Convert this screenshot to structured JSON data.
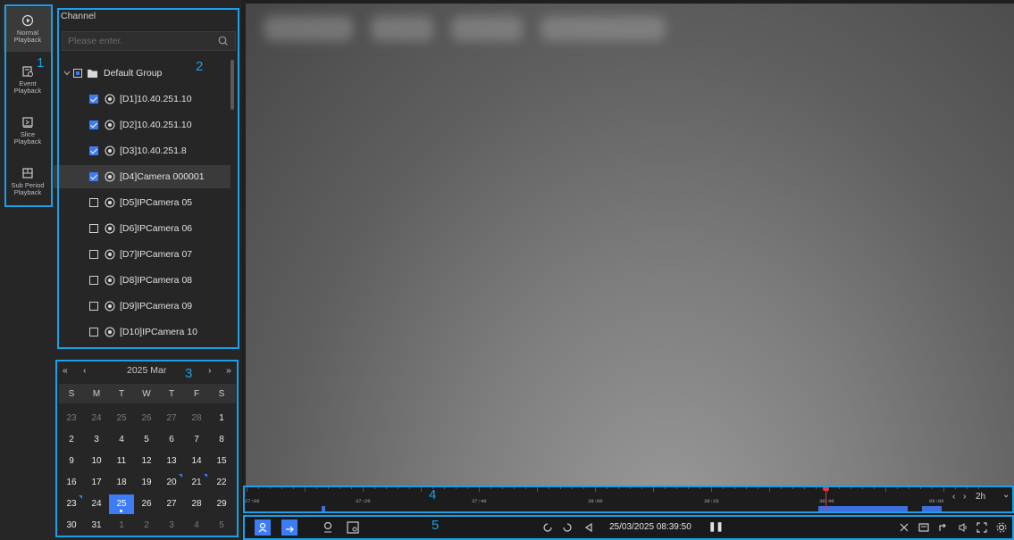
{
  "modes": [
    {
      "label_top": "Normal",
      "label_bottom": "Playback",
      "icon": "normal-playback-icon"
    },
    {
      "label_top": "Event",
      "label_bottom": "Playback",
      "icon": "event-playback-icon"
    },
    {
      "label_top": "Slice",
      "label_bottom": "Playback",
      "icon": "slice-playback-icon"
    },
    {
      "label_top": "Sub Period",
      "label_bottom": "Playback",
      "icon": "sub-period-playback-icon"
    }
  ],
  "channel": {
    "title": "Channel",
    "search_placeholder": "Please enter.",
    "group": "Default Group",
    "items": [
      {
        "label": "[D1]10.40.251.10",
        "checked": true
      },
      {
        "label": "[D2]10.40.251.10",
        "checked": true
      },
      {
        "label": "[D3]10.40.251.8",
        "checked": true
      },
      {
        "label": "[D4]Camera 000001",
        "checked": true
      },
      {
        "label": "[D5]IPCamera 05",
        "checked": false
      },
      {
        "label": "[D6]IPCamera 06",
        "checked": false
      },
      {
        "label": "[D7]IPCamera 07",
        "checked": false
      },
      {
        "label": "[D8]IPCamera 08",
        "checked": false
      },
      {
        "label": "[D9]IPCamera 09",
        "checked": false
      },
      {
        "label": "[D10]IPCamera 10",
        "checked": false
      }
    ]
  },
  "calendar": {
    "title": "2025 Mar",
    "prev_year": "«",
    "prev_month": "‹",
    "next_month": "›",
    "next_year": "»",
    "weekdays": [
      "S",
      "M",
      "T",
      "W",
      "T",
      "F",
      "S"
    ],
    "weeks": [
      [
        "23",
        "24",
        "25",
        "26",
        "27",
        "28",
        "1"
      ],
      [
        "2",
        "3",
        "4",
        "5",
        "6",
        "7",
        "8"
      ],
      [
        "9",
        "10",
        "11",
        "12",
        "13",
        "14",
        "15"
      ],
      [
        "16",
        "17",
        "18",
        "19",
        "20",
        "21",
        "22"
      ],
      [
        "23",
        "24",
        "25",
        "26",
        "27",
        "28",
        "29"
      ],
      [
        "30",
        "31",
        "1",
        "2",
        "3",
        "4",
        "5"
      ]
    ],
    "selected": "25",
    "accent": "#3d7cf4"
  },
  "timeline": {
    "labels": [
      "27:00",
      "37:20",
      "37:40",
      "38:00",
      "38:20",
      "38:40",
      "09:00"
    ],
    "zoom": "2h",
    "prev": "‹",
    "next": "›",
    "zoom_arrow": "⌄"
  },
  "toolbar": {
    "datetime": "25/03/2025 08:39:50",
    "pause": "❚❚"
  },
  "annotations": [
    "1",
    "2",
    "3",
    "4",
    "5"
  ]
}
